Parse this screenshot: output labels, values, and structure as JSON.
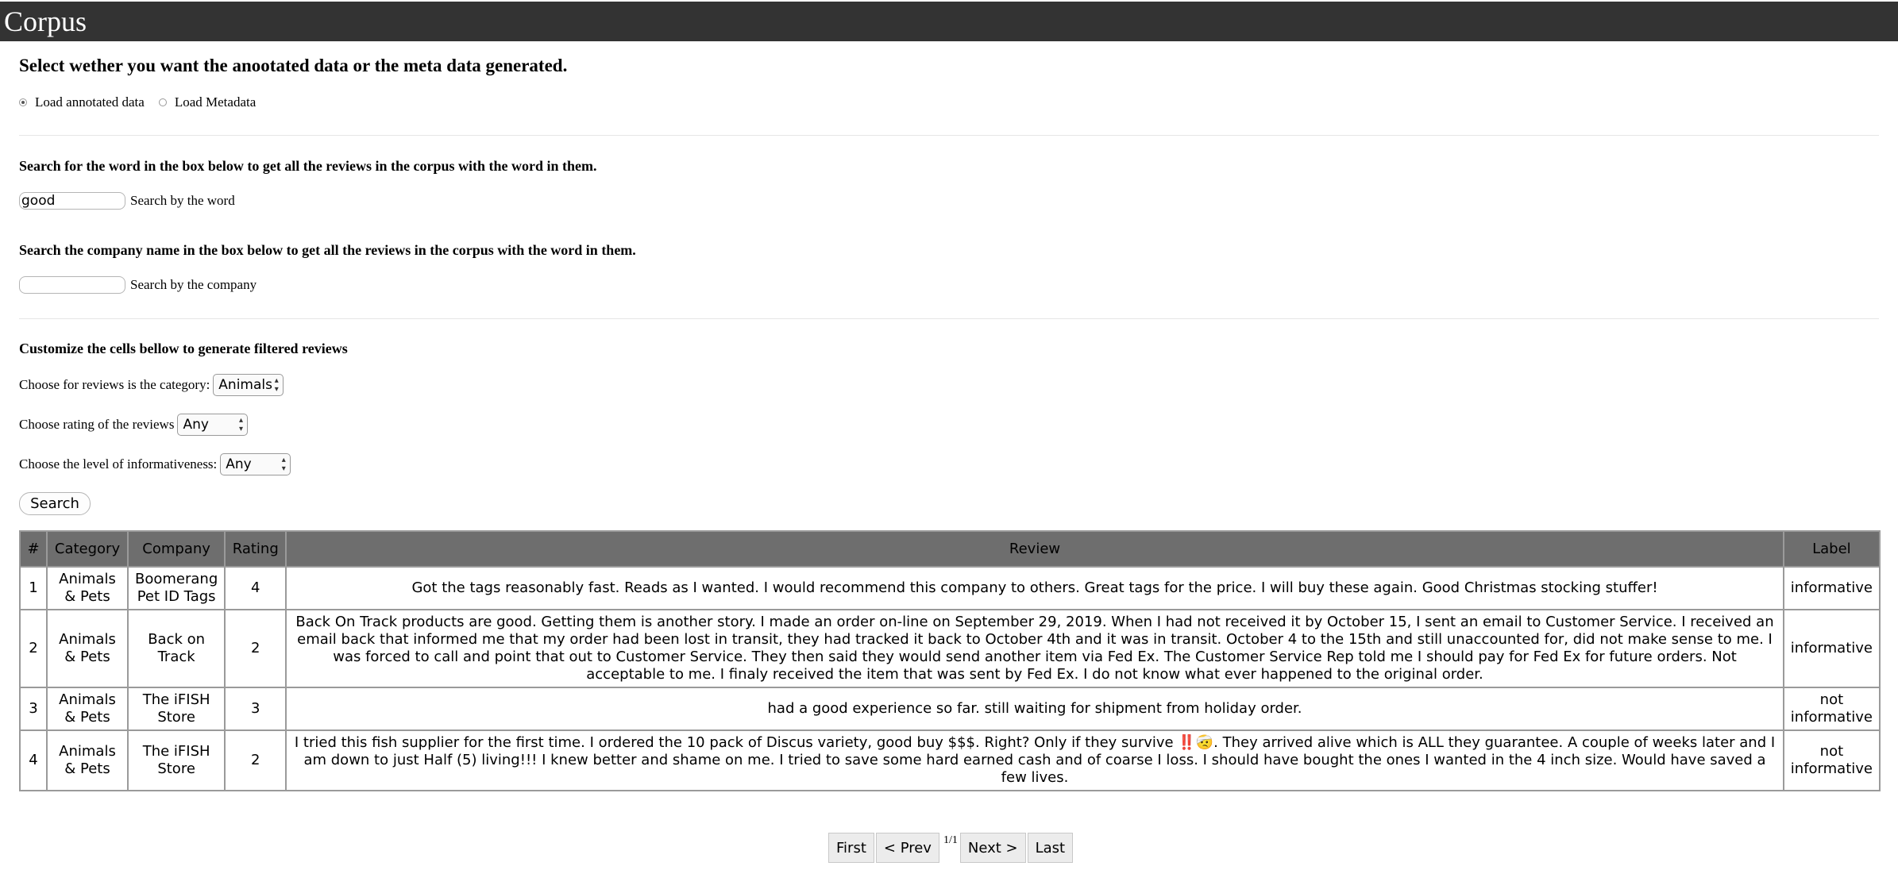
{
  "header": {
    "title": "Corpus"
  },
  "data_select": {
    "heading": "Select wether you want the anootated data or the meta data generated.",
    "options": [
      {
        "label": "Load annotated data",
        "selected": true
      },
      {
        "label": "Load Metadata",
        "selected": false
      }
    ]
  },
  "word_search": {
    "heading": "Search for the word in the box below to get all the reviews in the corpus with the word in them.",
    "value": "good",
    "label": "Search by the word"
  },
  "company_search": {
    "heading": "Search the company name in the box below to get all the reviews in the corpus with the word in them.",
    "value": "",
    "label": "Search by the company"
  },
  "filters": {
    "heading": "Customize the cells bellow to generate filtered reviews",
    "category_label": "Choose for reviews is the category:",
    "category_value": "Animals",
    "rating_label": "Choose rating of the reviews",
    "rating_value": "Any",
    "info_label": "Choose the level of informativeness:",
    "info_value": "Any",
    "search_button": "Search"
  },
  "table": {
    "headers": [
      "#",
      "Category",
      "Company",
      "Rating",
      "Review",
      "Label"
    ],
    "rows": [
      [
        "1",
        "Animals & Pets",
        "Boomerang Pet ID Tags",
        "4",
        "Got the tags reasonably fast. Reads as I wanted. I would recommend this company to others. Great tags for the price. I will buy these again. Good Christmas stocking stuffer!",
        "informative"
      ],
      [
        "2",
        "Animals & Pets",
        "Back on Track",
        "2",
        "Back On Track products are good. Getting them is another story. I made an order on-line on September 29, 2019. When I had not received it by October 15, I sent an email to Customer Service. I received an email back that informed me that my order had been lost in transit, they had tracked it back to October 4th and it was in transit. October 4 to the 15th and still unaccounted for, did not make sense to me. I was forced to call and point that out to Customer Service. They then said they would send another item via Fed Ex. The Customer Service Rep told me I should pay for Fed Ex for future orders. Not acceptable to me. I finaly received the item that was sent by Fed Ex. I do not know what ever happened to the original order.",
        "informative"
      ],
      [
        "3",
        "Animals & Pets",
        "The iFISH Store",
        "3",
        "had a good experience so far. still waiting for shipment from holiday order.",
        "not informative"
      ],
      [
        "4",
        "Animals & Pets",
        "The iFISH Store",
        "2",
        "I tried this fish supplier for the first time. I ordered the 10 pack of Discus variety, good buy $$$. Right? Only if they survive ‼️🤕. They arrived alive which is ALL they guarantee. A couple of weeks later and I am down to just Half (5) living!!! I knew better and shame on me. I tried to save some hard earned cash and of coarse I loss. I should have bought the ones I wanted in the 4 inch size. Would have saved a few lives.",
        "not informative"
      ]
    ]
  },
  "pagination": {
    "first": "First",
    "prev": "< Prev",
    "page_info": "1/1",
    "next": "Next >",
    "last": "Last"
  }
}
